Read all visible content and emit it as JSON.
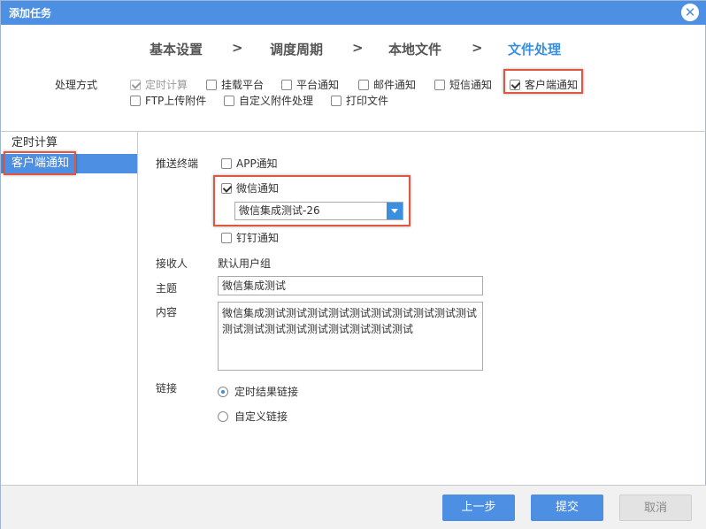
{
  "window": {
    "title": "添加任务",
    "close_symbol": "✕"
  },
  "steps": [
    {
      "label": "基本设置"
    },
    {
      "label": "调度周期"
    },
    {
      "label": "本地文件"
    },
    {
      "label": "文件处理",
      "active": true
    }
  ],
  "step_separator": ">",
  "processing": {
    "label": "处理方式",
    "options": [
      {
        "label": "定时计算",
        "checked": true,
        "disabled": true
      },
      {
        "label": "挂载平台",
        "checked": false
      },
      {
        "label": "平台通知",
        "checked": false
      },
      {
        "label": "邮件通知",
        "checked": false
      },
      {
        "label": "短信通知",
        "checked": false
      },
      {
        "label": "客户端通知",
        "checked": true
      },
      {
        "label": "FTP上传附件",
        "checked": false
      },
      {
        "label": "自定义附件处理",
        "checked": false
      },
      {
        "label": "打印文件",
        "checked": false
      }
    ]
  },
  "sidebar": {
    "items": [
      {
        "label": "定时计算",
        "selected": false
      },
      {
        "label": "客户端通知",
        "selected": true
      }
    ]
  },
  "form": {
    "push_terminal": {
      "label": "推送终端",
      "app": {
        "label": "APP通知",
        "checked": false
      },
      "wechat": {
        "label": "微信通知",
        "checked": true
      },
      "wechat_select": {
        "value": "微信集成测试-26"
      },
      "dingtalk": {
        "label": "钉钉通知",
        "checked": false
      }
    },
    "receiver": {
      "label": "接收人",
      "value": "默认用户组"
    },
    "subject": {
      "label": "主题",
      "value": "微信集成测试"
    },
    "content": {
      "label": "内容",
      "value": "微信集成测试测试测试测试测试测试测试测试测试测试测试测试测试测试测试测试测试测试测试"
    },
    "link": {
      "label": "链接",
      "options": [
        {
          "label": "定时结果链接",
          "selected": true
        },
        {
          "label": "自定义链接",
          "selected": false
        }
      ]
    }
  },
  "footer": {
    "prev_label": "上一步",
    "submit_label": "提交",
    "cancel_label": "取消"
  },
  "colors": {
    "accent": "#4c8fe3",
    "highlight_border": "#e0573f"
  },
  "icons": {
    "close": "close-icon",
    "dropdown": "chevron-down-icon"
  }
}
